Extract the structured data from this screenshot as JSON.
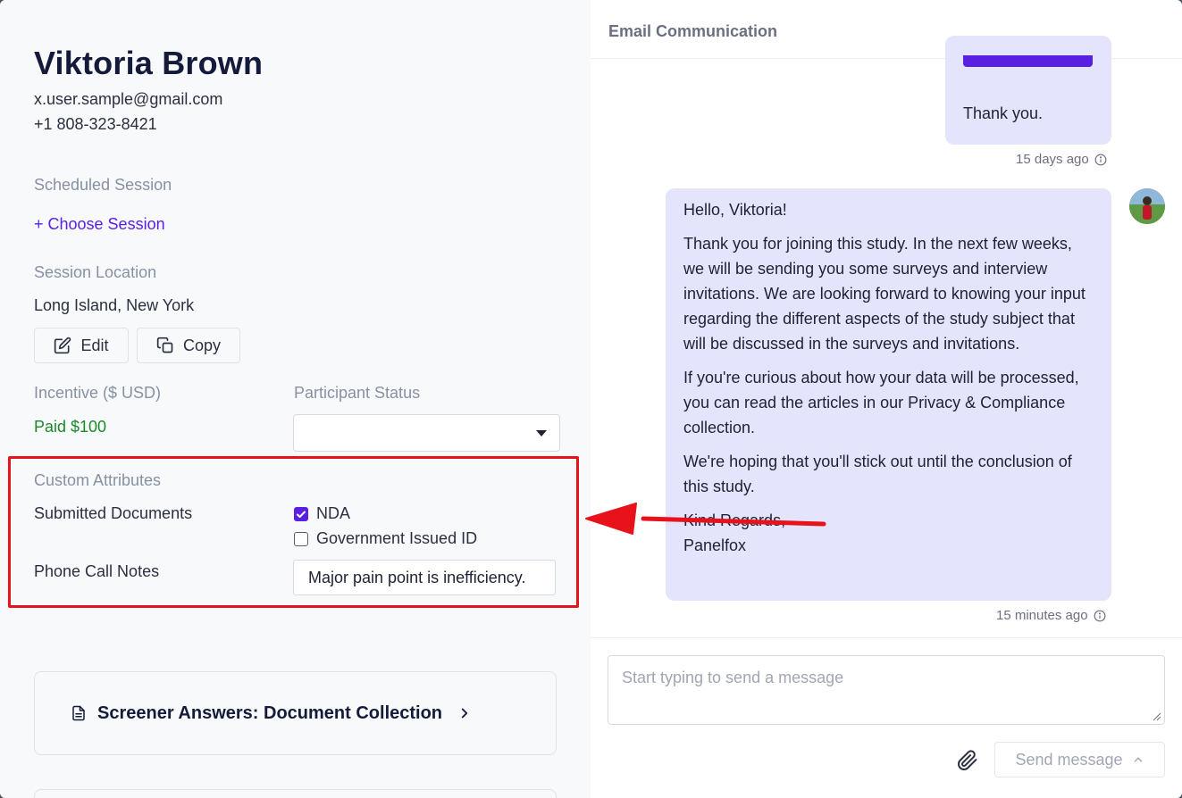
{
  "participant": {
    "name": "Viktoria Brown",
    "email": "x.user.sample@gmail.com",
    "phone": "+1 808-323-8421"
  },
  "scheduled_session": {
    "label": "Scheduled Session",
    "choose_label": "+ Choose Session"
  },
  "session_location": {
    "label": "Session Location",
    "value": "Long Island, New York",
    "edit_label": "Edit",
    "copy_label": "Copy"
  },
  "incentive": {
    "label": "Incentive ($ USD)",
    "value": "Paid $100"
  },
  "participant_status": {
    "label": "Participant Status",
    "value": ""
  },
  "custom_attributes": {
    "label": "Custom Attributes",
    "submitted_documents_label": "Submitted Documents",
    "documents": [
      {
        "label": "NDA",
        "checked": true
      },
      {
        "label": "Government Issued ID",
        "checked": false
      }
    ],
    "phone_notes_label": "Phone Call Notes",
    "phone_notes_value": "Major pain point is inefficiency."
  },
  "screener": {
    "title": "Screener Answers: Document Collection"
  },
  "email_panel": {
    "title": "Email Communication",
    "messages": [
      {
        "text": "Thank you.",
        "time": "15 days ago"
      },
      {
        "paragraphs": [
          "Hello, Viktoria!",
          "Thank you for joining this study. In the next few weeks, we will be sending you some surveys and interview invitations. We are looking forward to knowing your input regarding the different aspects of the study subject that will be discussed in the surveys and invitations.",
          "If you're curious about how your data will be processed, you can read the articles in our Privacy & Compliance collection.",
          "We're hoping that you'll stick out until the conclusion of this study."
        ],
        "sign_off": "Kind Regards,",
        "sender": "Panelfox",
        "time": "15 minutes ago"
      }
    ],
    "composer_placeholder": "Start typing to send a message",
    "send_label": "Send message"
  },
  "colors": {
    "accent": "#5a1fe0",
    "paid": "#1c8a2a",
    "highlight": "#e8131a",
    "bubble": "#e4e4fd"
  }
}
